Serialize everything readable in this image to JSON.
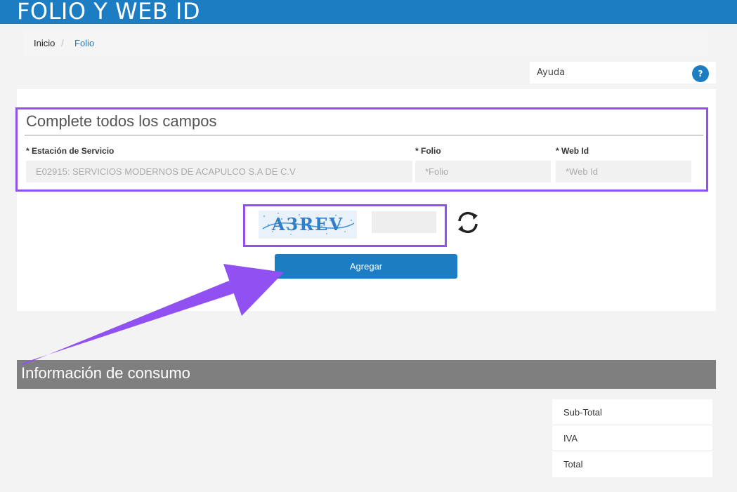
{
  "header": {
    "title": "FOLIO Y WEB ID"
  },
  "breadcrumb": {
    "items": [
      "Inicio",
      "Folio"
    ],
    "separator": "/"
  },
  "help": {
    "label": "Ayuda",
    "icon": "question-icon",
    "glyph": "?"
  },
  "form": {
    "title": "Complete todos los campos",
    "station": {
      "label": "* Estación de Servicio",
      "value": "E02915: SERVICIOS MODERNOS DE ACAPULCO S.A DE C.V"
    },
    "folio": {
      "label": "* Folio",
      "placeholder": "*Folio"
    },
    "webid": {
      "label": "* Web Id",
      "placeholder": "*Web Id"
    },
    "captcha": {
      "text": "A3REV",
      "refresh_icon": "refresh-icon"
    },
    "add_label": "Agregar"
  },
  "consumo": {
    "title": "Información de consumo",
    "rows": [
      "Sub-Total",
      "IVA",
      "Total"
    ]
  },
  "colors": {
    "primary": "#1d7dc2",
    "highlight": "#9150f2",
    "section": "#7f7f7f"
  }
}
